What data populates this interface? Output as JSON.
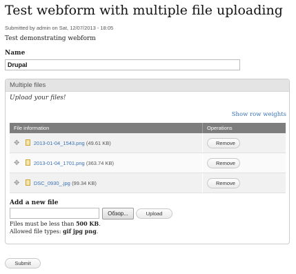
{
  "page": {
    "title": "Test webform with multiple file uploading",
    "submitted": "Submitted by admin on Sat, 12/07/2013 - 18:05",
    "intro": "Test demonstrating webform"
  },
  "name_field": {
    "label": "Name",
    "value": "Drupal"
  },
  "multiple_files": {
    "legend": "Multiple files",
    "description": "Upload your files!",
    "row_weights_link": "Show row weights",
    "columns": [
      "File information",
      "Operations"
    ],
    "files": [
      {
        "name": "2013-01-04_1543.png",
        "size": "(49.61 KB)",
        "action": "Remove"
      },
      {
        "name": "2013-01-04_1701.png",
        "size": "(363.74 KB)",
        "action": "Remove"
      },
      {
        "name": "DSC_0930_.jpg",
        "size": "(99.34 KB)",
        "action": "Remove"
      }
    ],
    "add_label": "Add a new file",
    "browse_label": "Обзор...",
    "upload_label": "Upload",
    "hint_size_prefix": "Files must be less than ",
    "hint_size_value": "500 KB",
    "hint_size_suffix": ".",
    "hint_types_prefix": "Allowed file types: ",
    "hint_types_value": "gif jpg png",
    "hint_types_suffix": "."
  },
  "submit_label": "Submit",
  "colors": {
    "link": "#3872b8",
    "table_header": "#7d7d7d"
  },
  "icons": {
    "drag": "drag-handle-icon",
    "file": "image-file-icon"
  }
}
